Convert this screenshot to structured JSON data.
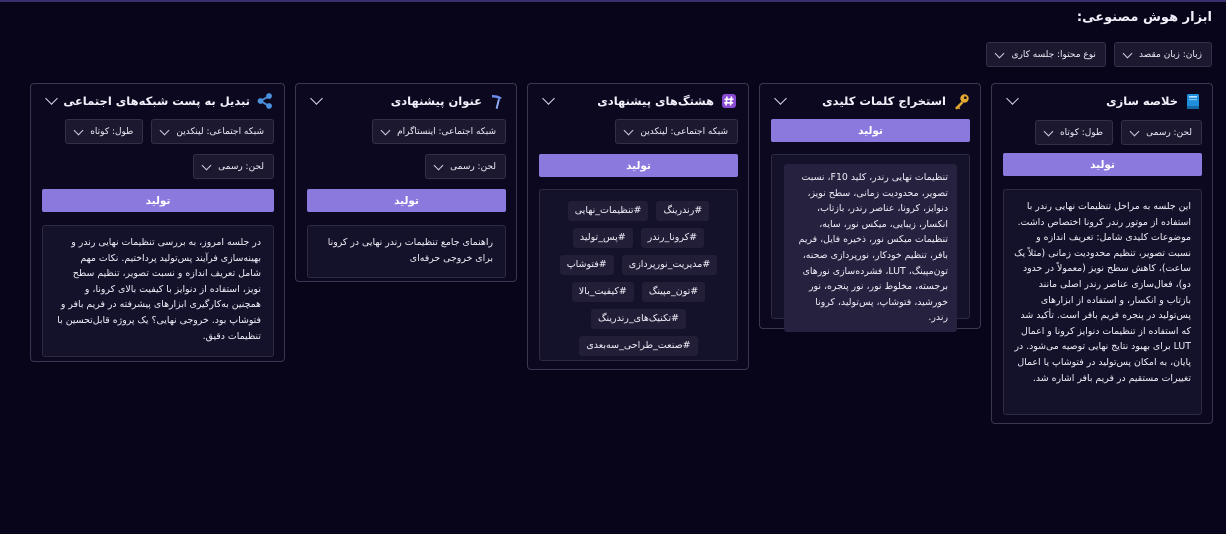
{
  "page_title": "ابزار هوش مصنوعی:",
  "global_selects": {
    "language": "زبان: زبان مقصد",
    "content_type": "نوع محتوا: جلسه کاری"
  },
  "cards": {
    "summary": {
      "title": "خلاصه سازی",
      "icon": "book-icon",
      "tone": "لحن: رسمی",
      "length": "طول: کوتاه",
      "generate": "تولید",
      "output": "این جلسه به مراحل تنظیمات نهایی رندر با استفاده از موتور رندر کرونا اختصاص داشت. موضوعات کلیدی شامل: تعریف اندازه و نسبت تصویر، تنظیم محدودیت زمانی (مثلاً یک ساعت)، کاهش سطح نویز (معمولاً در حدود دو)، فعال‌سازی عناصر رندر اصلی مانند بازتاب و انکسار، و استفاده از ابزارهای پس‌تولید در پنجره فریم بافر است. تأکید شد که استفاده از تنظیمات دنوایز کرونا و اعمال LUT برای بهبود نتایج نهایی توصیه می‌شود. در پایان، به امکان پس‌تولید در فتوشاپ یا اعمال تغییرات مستقیم در فریم بافر اشاره شد."
    },
    "keywords": {
      "title": "استخراج کلمات کلیدی",
      "icon": "key-icon",
      "generate": "تولید",
      "output": "تنظیمات نهایی رندر، کلید F10، نسبت تصویر، محدودیت زمانی، سطح نویز، دنوایز، کرونا، عناصر رندر، بازتاب، انکسار، زیبایی، میکس نور، سایه، تنظیمات میکس نور، ذخیره فایل، فریم بافر، تنظیم خودکار، نورپردازی صحنه، تون‌مپینگ، LUT، فشرده‌سازی نورهای برجسته، مخلوط نور، نور پنجره، نور خورشید، فتوشاپ، پس‌تولید، کرونا رندر."
    },
    "hashtags": {
      "title": "هشتگ‌های پیشنهادی",
      "icon": "hash-icon",
      "network": "شبکه اجتماعی: لینکدین",
      "generate": "تولید",
      "tags": [
        [
          "#رندرینگ",
          "#تنظیمات_نهایی"
        ],
        [
          "#کرونا_رندر",
          "#پس_تولید"
        ],
        [
          "#مدیریت_نورپردازی",
          "#فتوشاپ"
        ],
        [
          "#تون_مپینگ",
          "#کیفیت_بالا"
        ],
        [
          "#تکنیک‌های_رندرینگ"
        ],
        [
          "#صنعت_طراحی_سه‌بعدی"
        ]
      ]
    },
    "title_suggest": {
      "title": "عنوان پیشنهادی",
      "icon": "pen-icon",
      "network": "شبکه اجتماعی: اینستاگرام",
      "tone": "لحن: رسمی",
      "generate": "تولید",
      "output": "راهنمای جامع تنظیمات رندر نهایی در کرونا برای خروجی حرفه‌ای"
    },
    "social_post": {
      "title": "تبدیل به پست شبکه‌های اجتماعی",
      "icon": "share-icon",
      "network": "شبکه اجتماعی: لینکدین",
      "length": "طول: کوتاه",
      "tone": "لحن: رسمی",
      "generate": "تولید",
      "output": "در جلسه امروز، به بررسی تنظیمات نهایی رندر و بهینه‌سازی فرآیند پس‌تولید پرداختیم. نکات مهم شامل تعریف اندازه و نسبت تصویر، تنظیم سطح نویز، استفاده از دنوایز با کیفیت بالای کرونا، و همچنین به‌کارگیری ابزارهای پیشرفته در فریم بافر و فتوشاپ بود. خروجی نهایی؟ یک پروژه قابل‌تحسین با تنظیمات دقیق."
    }
  },
  "colors": {
    "background": "#08041a",
    "accent": "#8b79de",
    "card_border": "#3b3752"
  }
}
